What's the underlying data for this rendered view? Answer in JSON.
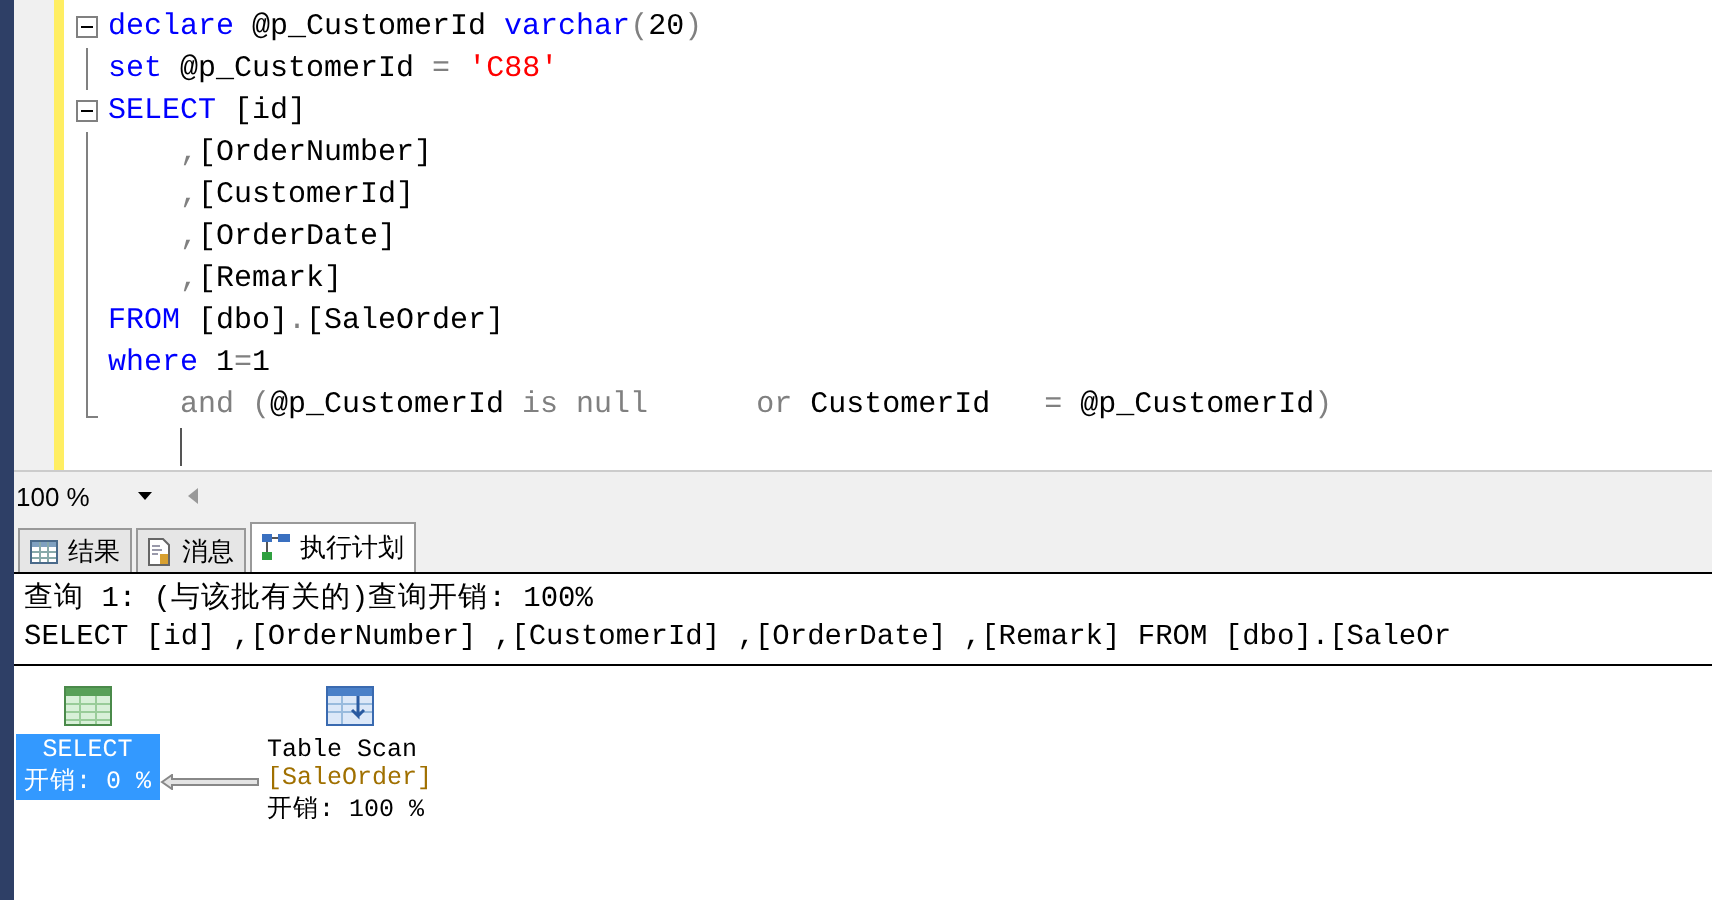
{
  "editor": {
    "lines": [
      {
        "tokens": [
          {
            "kind": "keyword",
            "text": "declare"
          },
          {
            "kind": "plain",
            "text": " @p_CustomerId "
          },
          {
            "kind": "keyword",
            "text": "varchar"
          },
          {
            "kind": "operator",
            "text": "("
          },
          {
            "kind": "plain",
            "text": "20"
          },
          {
            "kind": "operator",
            "text": ")"
          }
        ]
      },
      {
        "tokens": [
          {
            "kind": "keyword",
            "text": "set"
          },
          {
            "kind": "plain",
            "text": " @p_CustomerId "
          },
          {
            "kind": "operator",
            "text": "= "
          },
          {
            "kind": "string",
            "text": "'C88'"
          }
        ]
      },
      {
        "tokens": [
          {
            "kind": "keyword",
            "text": "SELECT"
          },
          {
            "kind": "plain",
            "text": " [id]"
          }
        ]
      },
      {
        "tokens": [
          {
            "kind": "operator",
            "text": "    ,"
          },
          {
            "kind": "plain",
            "text": "[OrderNumber]"
          }
        ]
      },
      {
        "tokens": [
          {
            "kind": "operator",
            "text": "    ,"
          },
          {
            "kind": "plain",
            "text": "[CustomerId]"
          }
        ]
      },
      {
        "tokens": [
          {
            "kind": "operator",
            "text": "    ,"
          },
          {
            "kind": "plain",
            "text": "[OrderDate]"
          }
        ]
      },
      {
        "tokens": [
          {
            "kind": "operator",
            "text": "    ,"
          },
          {
            "kind": "plain",
            "text": "[Remark]"
          }
        ]
      },
      {
        "tokens": [
          {
            "kind": "keyword",
            "text": "FROM"
          },
          {
            "kind": "plain",
            "text": " [dbo]"
          },
          {
            "kind": "operator",
            "text": "."
          },
          {
            "kind": "plain",
            "text": "[SaleOrder]"
          }
        ]
      },
      {
        "tokens": [
          {
            "kind": "keyword",
            "text": "where"
          },
          {
            "kind": "plain",
            "text": " 1"
          },
          {
            "kind": "operator",
            "text": "="
          },
          {
            "kind": "plain",
            "text": "1"
          }
        ]
      },
      {
        "tokens": [
          {
            "kind": "operator",
            "text": "    and ("
          },
          {
            "kind": "plain",
            "text": "@p_CustomerId "
          },
          {
            "kind": "operator",
            "text": "is null      or "
          },
          {
            "kind": "plain",
            "text": "CustomerId   "
          },
          {
            "kind": "operator",
            "text": "="
          },
          {
            "kind": "plain",
            "text": " @p_CustomerId"
          },
          {
            "kind": "operator",
            "text": ")"
          }
        ]
      }
    ]
  },
  "zoom": {
    "value": "100 %"
  },
  "tabs": [
    {
      "label": "结果",
      "selected": false
    },
    {
      "label": "消息",
      "selected": false
    },
    {
      "label": "执行计划",
      "selected": true
    }
  ],
  "plan": {
    "header": "查询 1: (与该批有关的)查询开销: 100%",
    "query": "SELECT [id] ,[OrderNumber] ,[CustomerId] ,[OrderDate] ,[Remark] FROM [dbo].[SaleOr",
    "nodes": [
      {
        "operator": "SELECT",
        "cost": "开销: 0 %",
        "selected": true
      },
      {
        "operator": "Table Scan",
        "object": "[SaleOrder]",
        "cost": "开销: 100 %",
        "selected": false
      }
    ]
  }
}
